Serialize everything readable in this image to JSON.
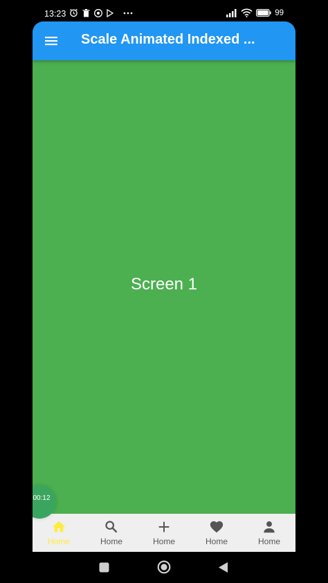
{
  "status_bar": {
    "time": "13:23",
    "battery": "99"
  },
  "app_bar": {
    "title": "Scale Animated Indexed ..."
  },
  "content": {
    "label": "Screen 1",
    "background_color": "#4CAF50"
  },
  "timer": {
    "text": "00:12"
  },
  "bottom_nav": {
    "items": [
      {
        "label": "Home",
        "icon": "home-icon",
        "active": true
      },
      {
        "label": "Home",
        "icon": "search-icon",
        "active": false
      },
      {
        "label": "Home",
        "icon": "plus-icon",
        "active": false
      },
      {
        "label": "Home",
        "icon": "heart-icon",
        "active": false
      },
      {
        "label": "Home",
        "icon": "person-icon",
        "active": false
      }
    ]
  },
  "colors": {
    "app_bar": "#2196F3",
    "active_nav": "#FFEB3B",
    "inactive_nav": "#555555"
  }
}
